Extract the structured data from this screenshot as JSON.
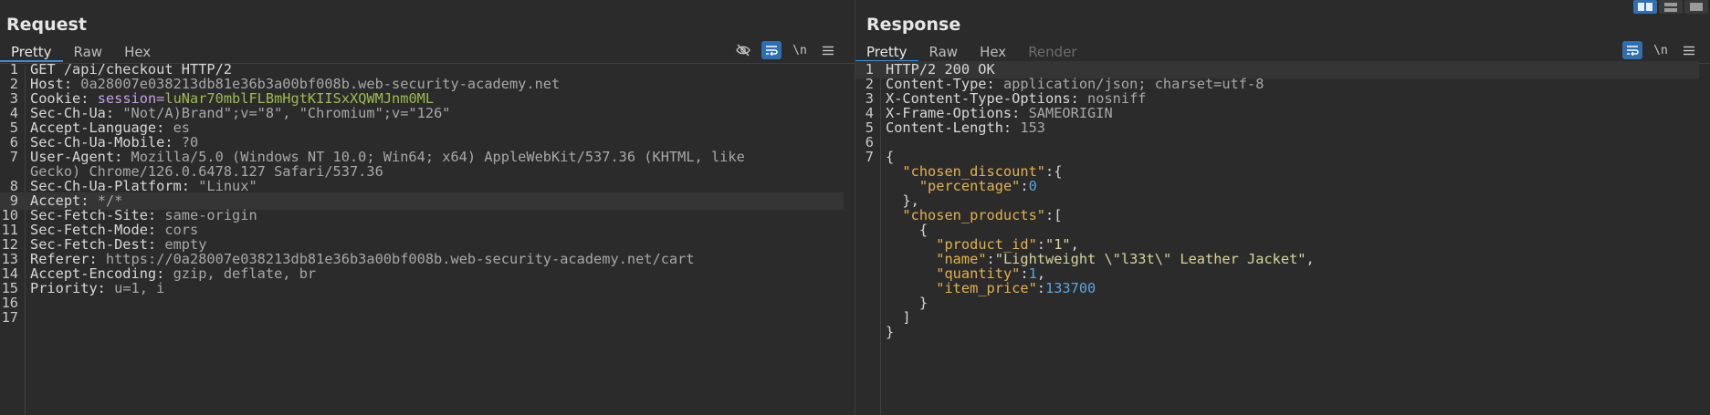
{
  "request": {
    "title": "Request",
    "tabs": [
      {
        "label": "Pretty",
        "active": true
      },
      {
        "label": "Raw"
      },
      {
        "label": "Hex"
      }
    ],
    "tools": [
      "eye-off-icon",
      "wrap-lines-icon",
      "\\n",
      "menu-icon"
    ],
    "lines": [
      {
        "n": "1",
        "k": "GET /api/checkout HTTP/2",
        "v": ""
      },
      {
        "n": "2",
        "k": "Host: ",
        "v": "0a28007e038213db81e36b3a00bf008b.web-security-academy.net"
      },
      {
        "n": "3",
        "k": "Cookie: ",
        "cn": "session=",
        "cv": "luNar70mblFLBmHgtKIISxXQWMJnm0ML"
      },
      {
        "n": "4",
        "k": "Sec-Ch-Ua: ",
        "v": "\"Not/A)Brand\";v=\"8\", \"Chromium\";v=\"126\""
      },
      {
        "n": "5",
        "k": "Accept-Language: ",
        "v": "es"
      },
      {
        "n": "6",
        "k": "Sec-Ch-Ua-Mobile: ",
        "v": "?0"
      },
      {
        "n": "7",
        "k": "User-Agent: ",
        "v": "Mozilla/5.0 (Windows NT 10.0; Win64; x64) AppleWebKit/537.36 (KHTML, like"
      },
      {
        "n": "",
        "k": "",
        "v": "Gecko) Chrome/126.0.6478.127 Safari/537.36"
      },
      {
        "n": "8",
        "k": "Sec-Ch-Ua-Platform: ",
        "v": "\"Linux\""
      },
      {
        "n": "9",
        "k": "Accept: ",
        "v": "*/*",
        "hl": true
      },
      {
        "n": "10",
        "k": "Sec-Fetch-Site: ",
        "v": "same-origin"
      },
      {
        "n": "11",
        "k": "Sec-Fetch-Mode: ",
        "v": "cors"
      },
      {
        "n": "12",
        "k": "Sec-Fetch-Dest: ",
        "v": "empty"
      },
      {
        "n": "13",
        "k": "Referer: ",
        "v": "https://0a28007e038213db81e36b3a00bf008b.web-security-academy.net/cart"
      },
      {
        "n": "14",
        "k": "Accept-Encoding: ",
        "v": "gzip, deflate, br"
      },
      {
        "n": "15",
        "k": "Priority: ",
        "v": "u=1, i"
      },
      {
        "n": "16",
        "k": "",
        "v": ""
      },
      {
        "n": "17",
        "k": "",
        "v": ""
      }
    ]
  },
  "response": {
    "title": "Response",
    "tabs": [
      {
        "label": "Pretty",
        "active": true
      },
      {
        "label": "Raw"
      },
      {
        "label": "Hex"
      },
      {
        "label": "Render",
        "disabled": true
      }
    ],
    "tools": [
      "wrap-lines-icon",
      "\\n",
      "menu-icon"
    ],
    "lines": [
      {
        "n": "1",
        "k": "HTTP/2 200 OK",
        "v": "",
        "hl": true
      },
      {
        "n": "2",
        "k": "Content-Type: ",
        "v": "application/json; charset=utf-8"
      },
      {
        "n": "3",
        "k": "X-Content-Type-Options: ",
        "v": "nosniff"
      },
      {
        "n": "4",
        "k": "X-Frame-Options: ",
        "v": "SAMEORIGIN"
      },
      {
        "n": "5",
        "k": "Content-Length: ",
        "v": "153"
      },
      {
        "n": "6",
        "k": "",
        "v": ""
      },
      {
        "n": "7",
        "p": "{"
      },
      {
        "n": "",
        "indent": "  ",
        "jk": "\"chosen_discount\"",
        "p": ":{"
      },
      {
        "n": "",
        "indent": "    ",
        "jk": "\"percentage\"",
        "p": ":",
        "jn": "0"
      },
      {
        "n": "",
        "indent": "  ",
        "p": "},"
      },
      {
        "n": "",
        "indent": "  ",
        "jk": "\"chosen_products\"",
        "p": ":["
      },
      {
        "n": "",
        "indent": "    ",
        "p": "{"
      },
      {
        "n": "",
        "indent": "      ",
        "jk": "\"product_id\"",
        "p": ":",
        "js": "\"1\"",
        "p2": ","
      },
      {
        "n": "",
        "indent": "      ",
        "jk": "\"name\"",
        "p": ":",
        "js": "\"Lightweight \\\"l33t\\\" Leather Jacket\"",
        "p2": ","
      },
      {
        "n": "",
        "indent": "      ",
        "jk": "\"quantity\"",
        "p": ":",
        "jn": "1",
        "p2": ","
      },
      {
        "n": "",
        "indent": "      ",
        "jk": "\"item_price\"",
        "p": ":",
        "jn": "133700"
      },
      {
        "n": "",
        "indent": "    ",
        "p": "}"
      },
      {
        "n": "",
        "indent": "  ",
        "p": "]"
      },
      {
        "n": "",
        "p": "}"
      }
    ]
  },
  "layout_toggles": [
    "split-vertical-icon",
    "split-horizontal-icon",
    "single-pane-icon"
  ],
  "colors": {
    "accent": "#2f6fb0",
    "cookie_value": "#9dbb51",
    "json_key": "#e3b14f",
    "json_string": "#d9d49b",
    "json_number": "#5aa6dd"
  }
}
